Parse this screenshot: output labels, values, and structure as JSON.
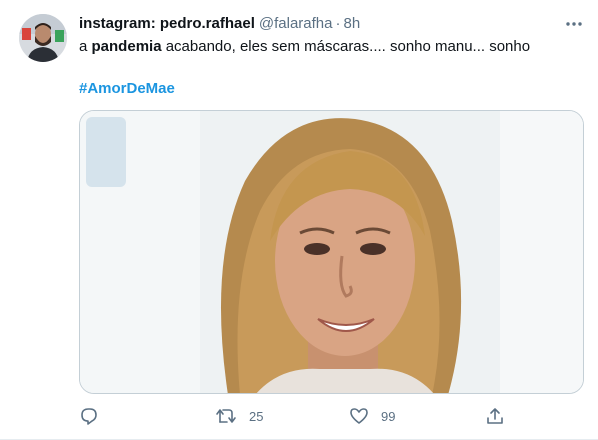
{
  "tweet": {
    "display_name": "instagram: pedro.rafhael",
    "handle": "@falarafha",
    "separator": "·",
    "time": "8h",
    "text_before": "a ",
    "text_bold": "pandemia",
    "text_after": " acabando, eles sem máscaras.... sonho manu... sonho",
    "hashtag": "#AmorDeMae"
  },
  "actions": {
    "reply_count": "",
    "retweet_count": "25",
    "like_count": "99"
  },
  "colors": {
    "link": "#1b95e0",
    "secondary_text": "#5b7083",
    "primary_text": "#0f1419"
  }
}
